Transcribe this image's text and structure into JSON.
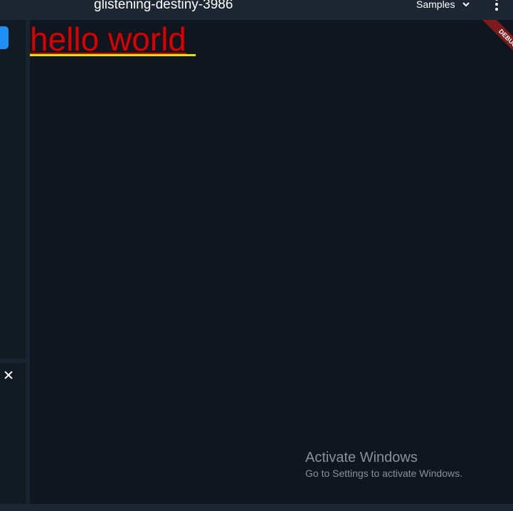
{
  "app": {
    "title": "glistening-destiny-3986",
    "samples_label": "Samples",
    "icons": {
      "samples_dropdown": "chevron-down-icon",
      "overflow_menu": "more-vert-icon",
      "panel_close": "close-icon"
    }
  },
  "preview": {
    "text": "hello world",
    "text_color": "#dd0000",
    "underline_color": "#e3e300",
    "debug_label": "DEBUG",
    "debug_color": "#7d1c1c"
  },
  "watermark": {
    "title": "Activate Windows",
    "subtitle": "Go to Settings to activate Windows."
  },
  "colors": {
    "accent": "#1f8ff5",
    "topbar": "#1d2733",
    "background": "#0f1620"
  }
}
